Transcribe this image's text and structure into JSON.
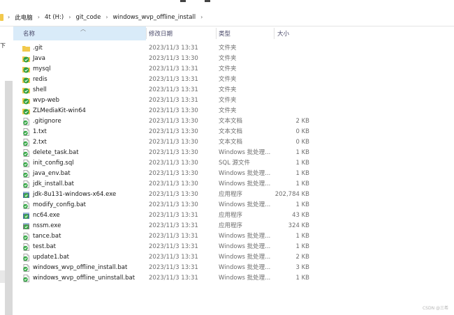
{
  "address": {
    "crumbs": [
      "此电脑",
      "4t (H:)",
      "git_code",
      "windows_wvp_offline_install"
    ]
  },
  "sidebar": {
    "fragment": "下"
  },
  "columns": {
    "name": "名称",
    "date": "修改日期",
    "type": "类型",
    "size": "大小"
  },
  "files": [
    {
      "name": ".git",
      "date": "2023/11/3 13:31",
      "type": "文件夹",
      "size": "",
      "icon": "plain-folder-icon"
    },
    {
      "name": "Java",
      "date": "2023/11/3 13:30",
      "type": "文件夹",
      "size": "",
      "icon": "git-folder-icon"
    },
    {
      "name": "mysql",
      "date": "2023/11/3 13:31",
      "type": "文件夹",
      "size": "",
      "icon": "git-folder-icon"
    },
    {
      "name": "redis",
      "date": "2023/11/3 13:31",
      "type": "文件夹",
      "size": "",
      "icon": "git-folder-icon"
    },
    {
      "name": "shell",
      "date": "2023/11/3 13:31",
      "type": "文件夹",
      "size": "",
      "icon": "git-folder-icon"
    },
    {
      "name": "wvp-web",
      "date": "2023/11/3 13:31",
      "type": "文件夹",
      "size": "",
      "icon": "git-folder-icon"
    },
    {
      "name": "ZLMediaKit-win64",
      "date": "2023/11/3 13:30",
      "type": "文件夹",
      "size": "",
      "icon": "git-folder-icon"
    },
    {
      "name": ".gitignore",
      "date": "2023/11/3 13:30",
      "type": "文本文档",
      "size": "2 KB",
      "icon": "text-file-icon"
    },
    {
      "name": "1.txt",
      "date": "2023/11/3 13:30",
      "type": "文本文档",
      "size": "0 KB",
      "icon": "text-file-icon"
    },
    {
      "name": "2.txt",
      "date": "2023/11/3 13:30",
      "type": "文本文档",
      "size": "0 KB",
      "icon": "text-file-icon"
    },
    {
      "name": "delete_task.bat",
      "date": "2023/11/3 13:30",
      "type": "Windows 批处理...",
      "size": "1 KB",
      "icon": "batch-file-icon"
    },
    {
      "name": "init_config.sql",
      "date": "2023/11/3 13:30",
      "type": "SQL 源文件",
      "size": "1 KB",
      "icon": "sql-file-icon"
    },
    {
      "name": "java_env.bat",
      "date": "2023/11/3 13:30",
      "type": "Windows 批处理...",
      "size": "1 KB",
      "icon": "batch-file-icon"
    },
    {
      "name": "jdk_install.bat",
      "date": "2023/11/3 13:30",
      "type": "Windows 批处理...",
      "size": "1 KB",
      "icon": "batch-file-icon"
    },
    {
      "name": "jdk-8u131-windows-x64.exe",
      "date": "2023/11/3 13:30",
      "type": "应用程序",
      "size": "202,784 KB",
      "icon": "exe-file-icon"
    },
    {
      "name": "modify_config.bat",
      "date": "2023/11/3 13:30",
      "type": "Windows 批处理...",
      "size": "1 KB",
      "icon": "batch-file-icon"
    },
    {
      "name": "nc64.exe",
      "date": "2023/11/3 13:31",
      "type": "应用程序",
      "size": "43 KB",
      "icon": "exe-file-icon"
    },
    {
      "name": "nssm.exe",
      "date": "2023/11/3 13:31",
      "type": "应用程序",
      "size": "324 KB",
      "icon": "nssm-exe-icon"
    },
    {
      "name": "tance.bat",
      "date": "2023/11/3 13:31",
      "type": "Windows 批处理...",
      "size": "1 KB",
      "icon": "batch-file-icon"
    },
    {
      "name": "test.bat",
      "date": "2023/11/3 13:31",
      "type": "Windows 批处理...",
      "size": "1 KB",
      "icon": "batch-file-icon"
    },
    {
      "name": "update1.bat",
      "date": "2023/11/3 13:31",
      "type": "Windows 批处理...",
      "size": "2 KB",
      "icon": "batch-file-icon"
    },
    {
      "name": "windows_wvp_offline_install.bat",
      "date": "2023/11/3 13:31",
      "type": "Windows 批处理...",
      "size": "3 KB",
      "icon": "batch-file-icon"
    },
    {
      "name": "windows_wvp_offline_uninstall.bat",
      "date": "2023/11/3 13:31",
      "type": "Windows 批处理...",
      "size": "1 KB",
      "icon": "batch-file-icon"
    }
  ],
  "watermark": "CSDN @三希",
  "colors": {
    "header_highlight": "#d9ebf9",
    "folder_yellow": "#f2c94c",
    "git_green": "#2e9e3e",
    "status_check_green": "#3aa84a"
  }
}
